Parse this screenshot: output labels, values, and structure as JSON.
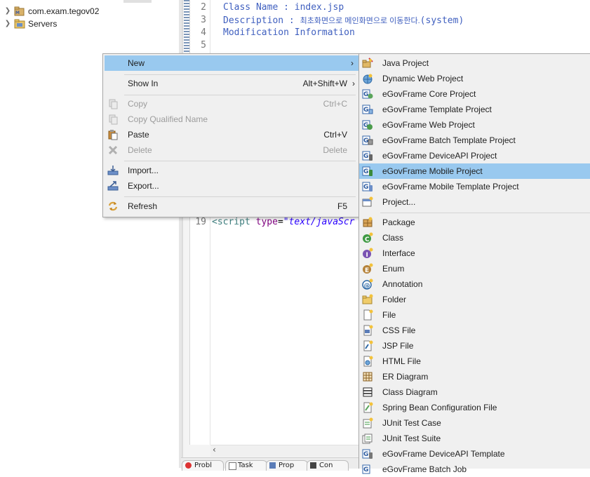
{
  "explorer": {
    "items": [
      {
        "label": "com.exam.tegov02",
        "icon": "project-icon"
      },
      {
        "label": "Servers",
        "icon": "folder-icon"
      }
    ]
  },
  "editor": {
    "lines": [
      {
        "num": "2",
        "text": "Class Name : index.jsp"
      },
      {
        "num": "3",
        "text": "Description : ",
        "korean": "최초화면으로 메인화면으로 이동한다.",
        "tail": "(system)"
      },
      {
        "num": "4",
        "text": "Modification Information"
      },
      {
        "num": "5",
        "text": ""
      }
    ],
    "line19": {
      "num": "19",
      "open": "<script ",
      "attr": "type",
      "eq": "=",
      "val": "\"text/javaScr"
    }
  },
  "context_menu": {
    "items": [
      {
        "label": "New",
        "accel": "",
        "submenu": true,
        "selected": true,
        "disabled": false,
        "icon": ""
      },
      {
        "label": "Show In",
        "accel": "Alt+Shift+W",
        "submenu": true,
        "selected": false,
        "disabled": false,
        "icon": ""
      },
      {
        "label": "Copy",
        "accel": "Ctrl+C",
        "disabled": true,
        "icon": "copy-icon"
      },
      {
        "label": "Copy Qualified Name",
        "accel": "",
        "disabled": true,
        "icon": "copy-qualified-icon"
      },
      {
        "label": "Paste",
        "accel": "Ctrl+V",
        "disabled": false,
        "icon": "paste-icon"
      },
      {
        "label": "Delete",
        "accel": "Delete",
        "disabled": true,
        "icon": "delete-icon"
      },
      {
        "label": "Import...",
        "accel": "",
        "disabled": false,
        "icon": "import-icon"
      },
      {
        "label": "Export...",
        "accel": "",
        "disabled": false,
        "icon": "export-icon"
      },
      {
        "label": "Refresh",
        "accel": "F5",
        "disabled": false,
        "icon": "refresh-icon"
      }
    ]
  },
  "submenu": {
    "items": [
      {
        "label": "Java Project",
        "icon": "java-project-icon"
      },
      {
        "label": "Dynamic Web Project",
        "icon": "dynamic-web-project-icon"
      },
      {
        "label": "eGovFrame Core Project",
        "icon": "egov-core-project-icon"
      },
      {
        "label": "eGovFrame Template Project",
        "icon": "egov-template-project-icon"
      },
      {
        "label": "eGovFrame Web Project",
        "icon": "egov-web-project-icon"
      },
      {
        "label": "eGovFrame Batch Template Project",
        "icon": "egov-batch-template-icon"
      },
      {
        "label": "eGovFrame DeviceAPI Project",
        "icon": "egov-deviceapi-project-icon"
      },
      {
        "label": "eGovFrame Mobile Project",
        "icon": "egov-mobile-project-icon",
        "selected": true
      },
      {
        "label": "eGovFrame Mobile Template Project",
        "icon": "egov-mobile-template-icon"
      },
      {
        "label": "Project...",
        "icon": "project-wizard-icon"
      },
      {
        "label": "Package",
        "icon": "package-icon"
      },
      {
        "label": "Class",
        "icon": "class-icon"
      },
      {
        "label": "Interface",
        "icon": "interface-icon"
      },
      {
        "label": "Enum",
        "icon": "enum-icon"
      },
      {
        "label": "Annotation",
        "icon": "annotation-icon"
      },
      {
        "label": "Folder",
        "icon": "folder-icon"
      },
      {
        "label": "File",
        "icon": "file-icon"
      },
      {
        "label": "CSS File",
        "icon": "css-file-icon"
      },
      {
        "label": "JSP File",
        "icon": "jsp-file-icon"
      },
      {
        "label": "HTML File",
        "icon": "html-file-icon"
      },
      {
        "label": "ER Diagram",
        "icon": "er-diagram-icon"
      },
      {
        "label": "Class Diagram",
        "icon": "class-diagram-icon"
      },
      {
        "label": "Spring Bean Configuration File",
        "icon": "spring-bean-icon"
      },
      {
        "label": "JUnit Test Case",
        "icon": "junit-test-case-icon"
      },
      {
        "label": "JUnit Test Suite",
        "icon": "junit-test-suite-icon"
      },
      {
        "label": "eGovFrame DeviceAPI Template",
        "icon": "egov-deviceapi-template-icon"
      },
      {
        "label": "eGovFrame Batch Job",
        "icon": "egov-batch-job-icon"
      }
    ]
  },
  "bottom_tabs": [
    {
      "label": "Probl"
    },
    {
      "label": "Task"
    },
    {
      "label": "Prop"
    },
    {
      "label": "Con"
    }
  ],
  "colors": {
    "selection": "#99c9ef",
    "menu_bg": "#f0f0f0",
    "comment_blue": "#3f5fbf",
    "tag_teal": "#3f7f7f",
    "attr_purple": "#7f007f",
    "string_blue": "#2a00ff"
  }
}
